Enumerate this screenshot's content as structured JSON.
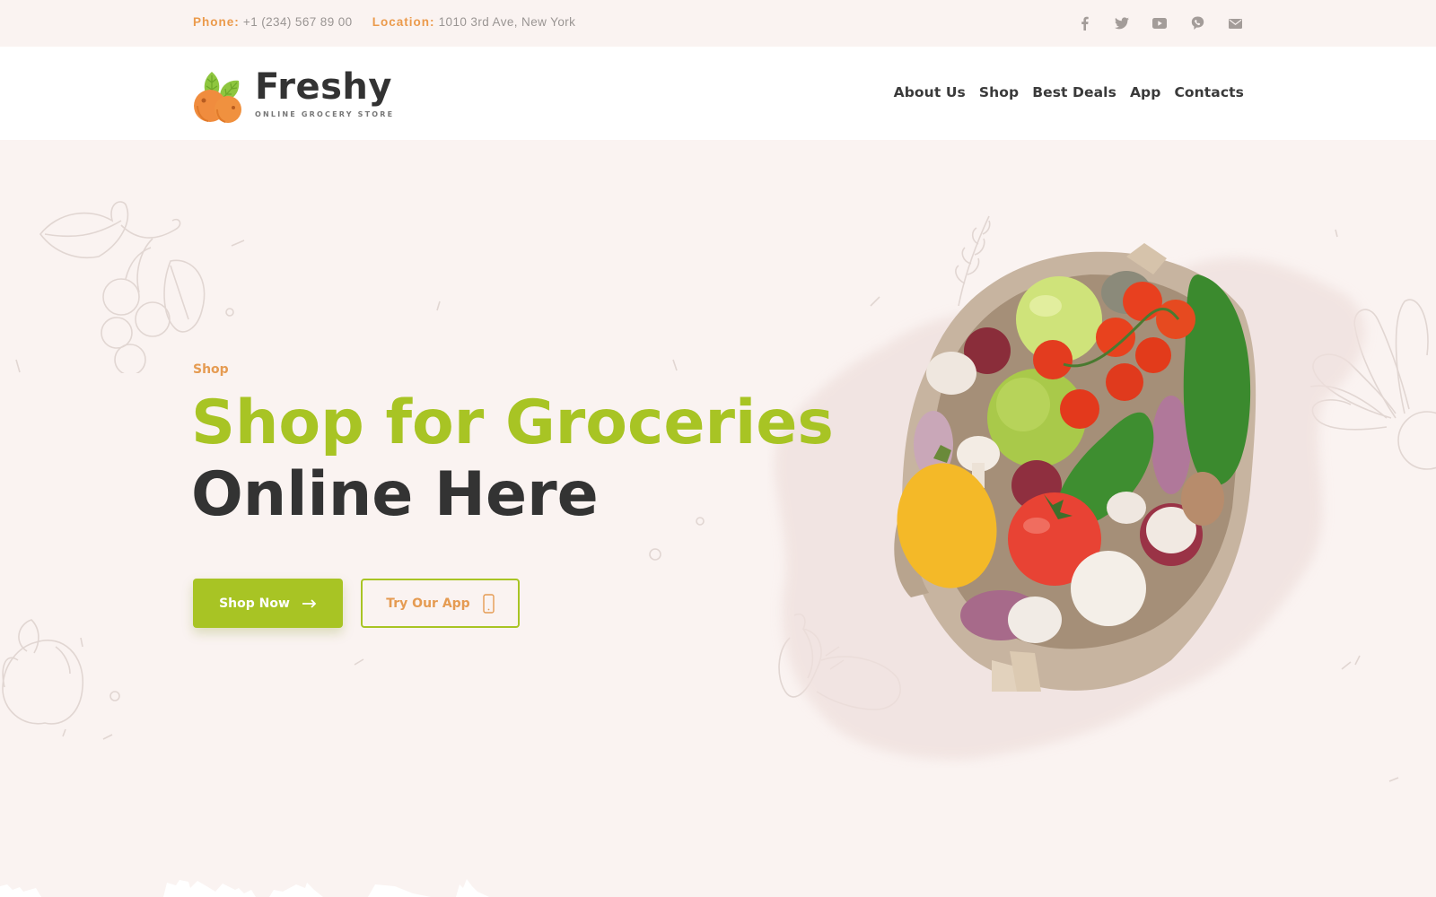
{
  "topbar": {
    "phone_label": "Phone:",
    "phone_value": "+1 (234) 567 89 00",
    "location_label": "Location:",
    "location_value": "1010 3rd Ave, New York",
    "socials": [
      {
        "name": "facebook",
        "icon": "facebook-icon"
      },
      {
        "name": "twitter",
        "icon": "twitter-icon"
      },
      {
        "name": "youtube",
        "icon": "youtube-icon"
      },
      {
        "name": "viber",
        "icon": "viber-icon"
      },
      {
        "name": "email",
        "icon": "mail-icon"
      }
    ]
  },
  "header": {
    "logo_name": "Freshy",
    "logo_tagline": "ONLINE GROCERY STORE",
    "nav": [
      {
        "label": "About Us"
      },
      {
        "label": "Shop"
      },
      {
        "label": "Best Deals"
      },
      {
        "label": "App"
      },
      {
        "label": "Contacts"
      }
    ]
  },
  "hero": {
    "eyebrow": "Shop",
    "title_line1": "Shop for Groceries",
    "title_line2": "Online Here",
    "primary_button": {
      "label": "Shop Now",
      "icon": "arrow-right-icon"
    },
    "secondary_button": {
      "label": "Try Our App",
      "icon": "smartphone-icon"
    },
    "image_alt": "Paper bag full of vegetables"
  },
  "colors": {
    "accent_green": "#a8c424",
    "accent_orange": "#e59b52",
    "heading_dark": "#333333",
    "background": "#faf3f1"
  }
}
